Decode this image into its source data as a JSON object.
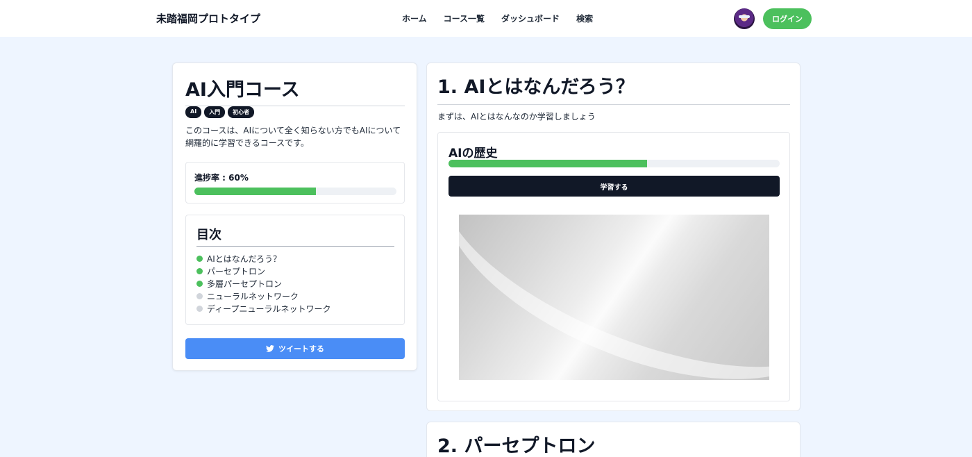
{
  "header": {
    "brand": "未踏福岡プロトタイプ",
    "nav": [
      "ホーム",
      "コース一覧",
      "ダッシュボード",
      "検索"
    ],
    "login_label": "ログイン"
  },
  "course": {
    "title": "AI入門コース",
    "tags": [
      "AI",
      "入門",
      "初心者"
    ],
    "description": "このコースは、AIについて全く知らない方でもAIについて網羅的に学習できるコースです。",
    "progress_label": "進捗率 : 60%",
    "progress": 0.6,
    "toc_title": "目次",
    "toc": [
      {
        "label": "AIとはなんだろう？",
        "done": true
      },
      {
        "label": "パーセプトロン",
        "done": true
      },
      {
        "label": "多層パーセプトロン",
        "done": true
      },
      {
        "label": "ニューラルネットワーク",
        "done": false
      },
      {
        "label": "ディープニューラルネットワーク",
        "done": false
      }
    ],
    "tweet_label": "ツイートする"
  },
  "lesson": {
    "title": "1. AIとはなんだろう？",
    "subtitle": "まずは、AIとはなんなのか学習しましょう",
    "section_title": "AIの歴史",
    "section_progress": 0.6,
    "study_label": "学習する"
  },
  "next_lesson": {
    "title": "2. パーセプトロン"
  },
  "colors": {
    "accent_green": "#4cc05d",
    "tweet_blue": "#4a8df6",
    "dark": "#111827",
    "pending_dot": "#d1d5db"
  }
}
